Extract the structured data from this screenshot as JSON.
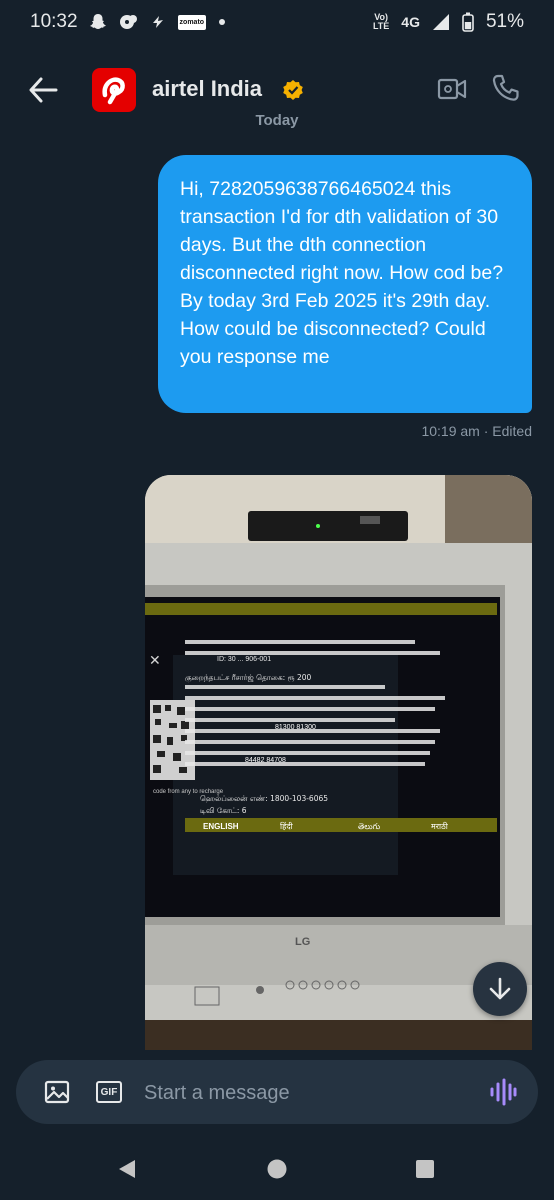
{
  "status_bar": {
    "time": "10:32",
    "network_volte_top": "Vo)",
    "network_volte_bottom": "LTE",
    "network_type": "4G",
    "battery": "51%",
    "notification_icons": [
      "snapchat-icon",
      "fan-notification-icon",
      "swiggy-icon",
      "zomato-icon",
      "dot-icon"
    ],
    "zomato_label": "zomato"
  },
  "header": {
    "contact_name": "airtel India",
    "verified": true,
    "brand_color": "#e40000",
    "verified_color": "#f5b000"
  },
  "conversation": {
    "date_separator": "Today",
    "messages": [
      {
        "text": "Hi, 7282059638766465024 this transaction I'd for dth validation of 30 days. But the dth connection disconnected right now. How cod be? By today 3rd Feb 2025 it's 29th day. How could be disconnected? Could you response me",
        "time": "10:19 am",
        "status": "Edited",
        "bubble_color": "#1d9bf0"
      }
    ],
    "photo": {
      "tv_screen_text": {
        "helpline": "ஹெல்ப்லைன் எண்: 1800-103-6065",
        "tv_code": "டிவி கோட்: 6",
        "languages": [
          "ENGLISH",
          "हिंदी",
          "తెలుగు",
          "मराठी"
        ],
        "brand": "LG",
        "rupee_amount": "குறைந்தபட்ச ரீசார்ஜ் தொகை: ரூ 200",
        "scan_text": "code from any to recharge",
        "id_partial": "ID: 30 ... 906-001",
        "sms_numbers": "81300 81300",
        "missed_call": "84482 84708"
      }
    }
  },
  "composer": {
    "placeholder": "Start a message",
    "gif_label": "GIF",
    "voice_color": "#a78bfa"
  },
  "nav": {
    "icons": [
      "back-triangle-icon",
      "home-circle-icon",
      "recents-square-icon"
    ]
  }
}
